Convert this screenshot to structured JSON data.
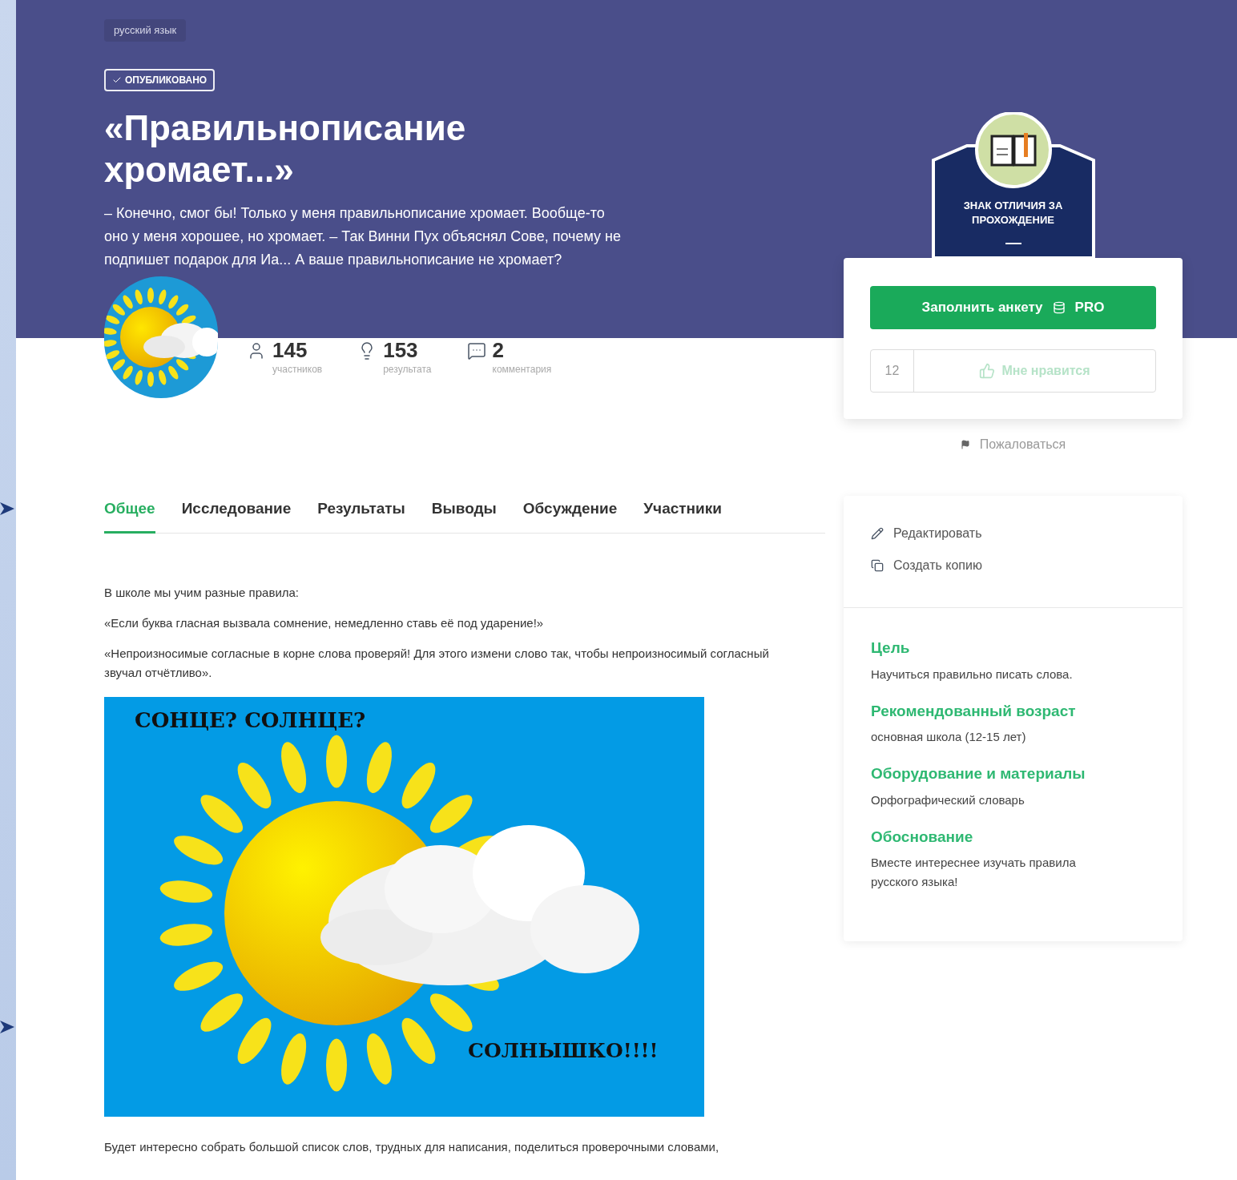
{
  "subject_tag": "русский язык",
  "status": "ОПУБЛИКОВАНО",
  "title": "«Правильнописание хромает...»",
  "description": "– Конечно, смог бы! Только у меня правильнописание хромает. Вообще-то оно у меня хорошее, но хромает. – Так Винни Пух объяснял Сове, почему не подпишет подарок для Иа... А ваше правильнописание не хромает?",
  "stats": [
    {
      "kind": "participants",
      "value": "145",
      "label": "участников"
    },
    {
      "kind": "results",
      "value": "153",
      "label": "результата"
    },
    {
      "kind": "comments",
      "value": "2",
      "label": "комментария"
    }
  ],
  "tabs": [
    {
      "label": "Общее",
      "selected": true
    },
    {
      "label": "Исследование",
      "selected": false
    },
    {
      "label": "Результаты",
      "selected": false
    },
    {
      "label": "Выводы",
      "selected": false
    },
    {
      "label": "Обсуждение",
      "selected": false
    },
    {
      "label": "Участники",
      "selected": false
    }
  ],
  "paragraphs": [
    "В школе мы учим разные правила:",
    "«Если буква гласная вызвала сомнение, немедленно ставь её под ударение!»",
    "«Непроизносимые согласные в корне слова проверяй! Для этого измени слово так, чтобы непроизносимый согласный звучал отчётливо»."
  ],
  "illustration": {
    "caption_top": "СОНЦЕ? СОЛНЦЕ?",
    "caption_bottom": "СОЛНЫШКО!!!!"
  },
  "footer_text": "Будет интересно собрать большой список слов, трудных для написания, поделиться проверочными словами,",
  "award_badge": {
    "caption": "ЗНАК ОТЛИЧИЯ ЗА ПРОХОЖДЕНИЕ"
  },
  "primary_button": {
    "label": "Заполнить анкету",
    "tag": "PRO"
  },
  "like": {
    "count": "12",
    "label": "Мне нравится",
    "disabled": true
  },
  "report_link": "Пожаловаться",
  "actions": [
    {
      "kind": "edit",
      "label": "Редактировать"
    },
    {
      "kind": "copy",
      "label": "Создать копию"
    }
  ],
  "info_sections": [
    {
      "heading": "Цель",
      "text": "Научиться правильно писать слова."
    },
    {
      "heading": "Рекомендованный возраст",
      "text": "основная школа (12-15 лет)"
    },
    {
      "heading": "Оборудование и материалы",
      "text": "Орфографический словарь"
    },
    {
      "heading": "Обоснование",
      "text": "Вместе интереснее изучать правила русского языка!"
    }
  ]
}
